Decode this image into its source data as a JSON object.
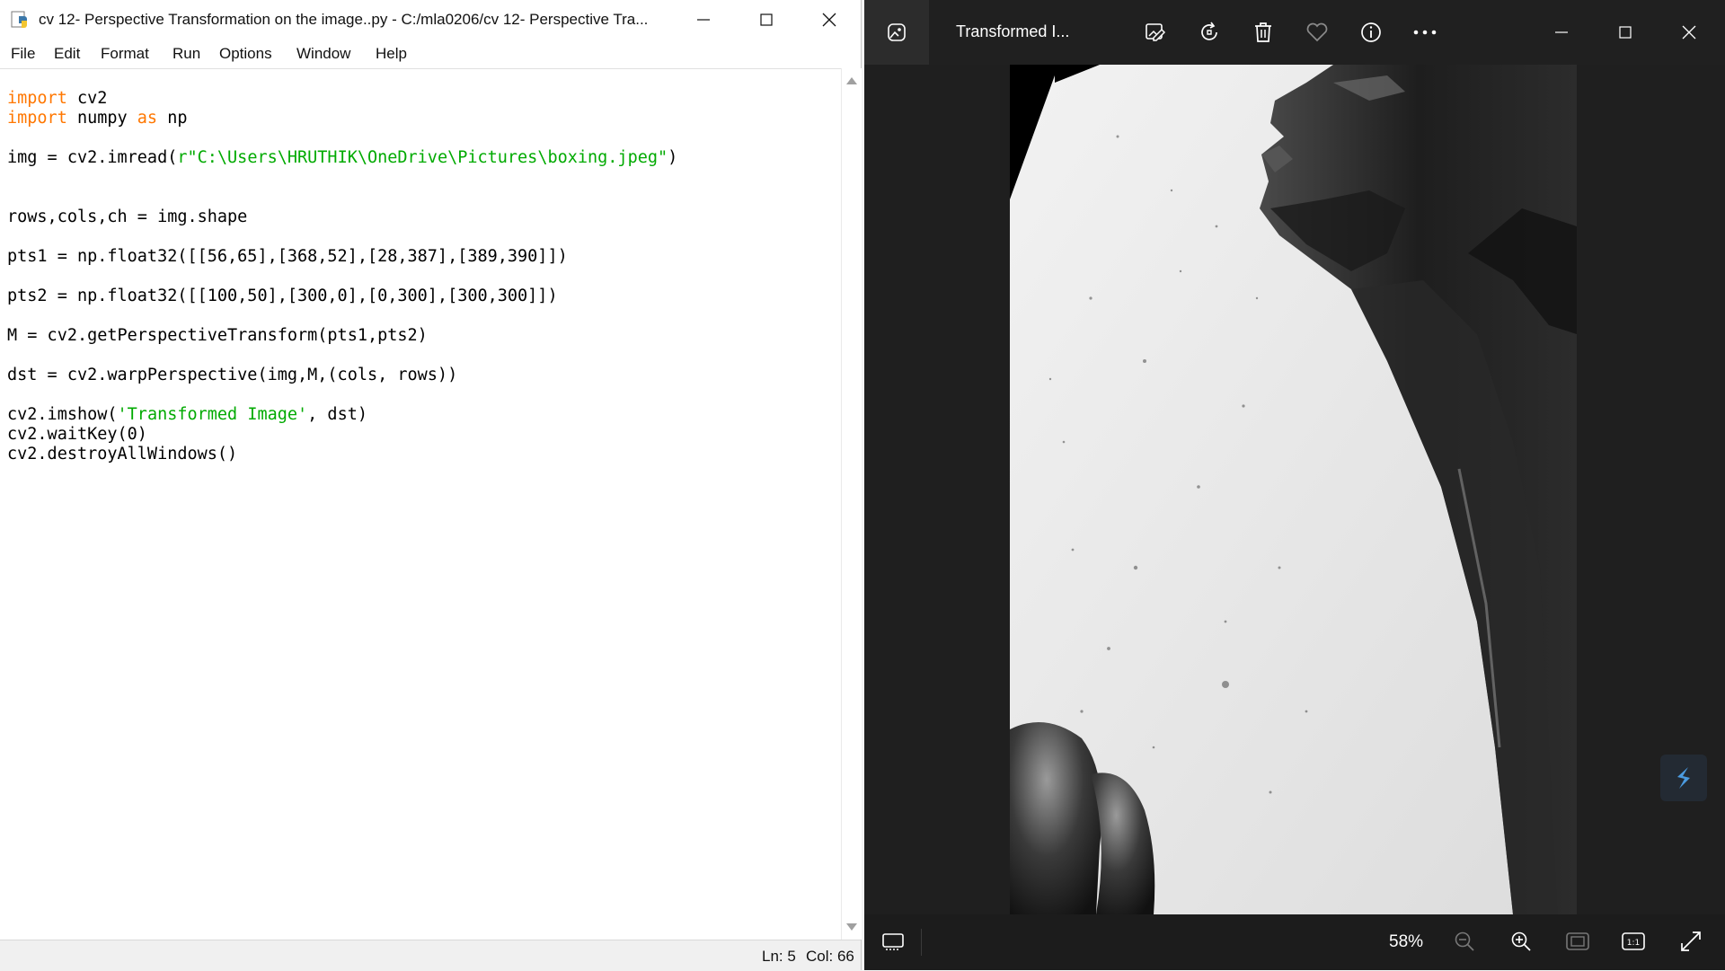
{
  "idle": {
    "title": "cv 12- Perspective Transformation on the image..py - C:/mla0206/cv 12- Perspective Tra...",
    "menu": [
      "File",
      "Edit",
      "Format",
      "Run",
      "Options",
      "Window",
      "Help"
    ],
    "code_lines": [
      {
        "kw": "import",
        "rest": " cv2"
      },
      {
        "kw": "import",
        "rest": " numpy ",
        "kw2": "as",
        "rest2": " np"
      },
      {
        "blank": true
      },
      {
        "pre": "img = cv2.imread(",
        "str": "r\"C:\\Users\\HRUTHIK\\OneDrive\\Pictures\\boxing.jpeg\"",
        "post": ")"
      },
      {
        "blank": true
      },
      {
        "blank": true
      },
      {
        "pre": "rows,cols,ch = img.shape"
      },
      {
        "blank": true
      },
      {
        "pre": "pts1 = np.float32([[56,65],[368,52],[28,387],[389,390]])"
      },
      {
        "blank": true
      },
      {
        "pre": "pts2 = np.float32([[100,50],[300,0],[0,300],[300,300]])"
      },
      {
        "blank": true
      },
      {
        "pre": "M = cv2.getPerspectiveTransform(pts1,pts2)"
      },
      {
        "blank": true
      },
      {
        "pre": "dst = cv2.warpPerspective(img,M,(cols, rows))"
      },
      {
        "blank": true
      },
      {
        "pre": "cv2.imshow(",
        "str": "'Transformed Image'",
        "post": ", dst)"
      },
      {
        "pre": "cv2.waitKey(0)"
      },
      {
        "pre": "cv2.destroyAllWindows()"
      }
    ],
    "status": {
      "line": "Ln: 5",
      "col": "Col: 66"
    },
    "colors": {
      "keyword": "#ff7700",
      "string": "#00aa00"
    }
  },
  "viewer": {
    "title": "Transformed I...",
    "zoom": "58%",
    "icons": [
      "photo-app-icon",
      "edit-image-icon",
      "rotate-icon",
      "delete-icon",
      "favorite-icon",
      "info-icon",
      "more-icon",
      "minimize-icon",
      "maximize-icon",
      "close-icon",
      "filmstrip-icon",
      "zoom-out-icon",
      "zoom-in-icon",
      "fit-to-window-icon",
      "actual-size-icon",
      "fullscreen-icon"
    ]
  }
}
